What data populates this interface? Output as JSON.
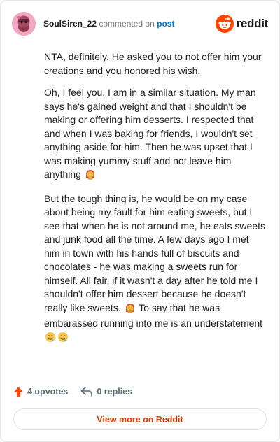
{
  "header": {
    "username": "SoulSiren_22",
    "action_text": "commented on",
    "target_text": "post",
    "brand_name": "reddit"
  },
  "comment": {
    "paragraphs": [
      "NTA, definitely. He asked you to not offer him your creations and you honored his wish.",
      "Oh, I feel you. I am in a similar situation. My man says he's gained weight and that I shouldn't be making or offering him desserts. I respected that and when I was baking for friends, I wouldn't set anything aside for him. Then he was upset that I was making yummy stuff and not leave him anything",
      "But the tough thing is, he would be on my case about being my fault for him eating sweets, but I see that when he is not around me, he eats sweets and junk food all the time. A few days ago I met him in town with his hands full of biscuits and chocolates - he was making a sweets run for himself. All fair, if it wasn't a day after he told me I shouldn't offer him dessert because he doesn't really like sweets.",
      "To say that he was embarassed running into me is an understatement"
    ]
  },
  "footer": {
    "upvotes_label": "4 upvotes",
    "replies_label": "0 replies",
    "view_more_label": "View more on Reddit"
  },
  "colors": {
    "brand": "#ff4500",
    "link": "#0079d3",
    "view_more": "#d93a00",
    "muted": "#576f76"
  },
  "icons": {
    "avatar": "snoo-avatar-icon",
    "brand": "reddit-logo-icon",
    "facepalm": "woman-facepalming-emoji-icon",
    "drooling": "drooling-face-emoji-icon",
    "upvote": "upvote-arrow-icon",
    "reply": "reply-arrow-icon"
  }
}
